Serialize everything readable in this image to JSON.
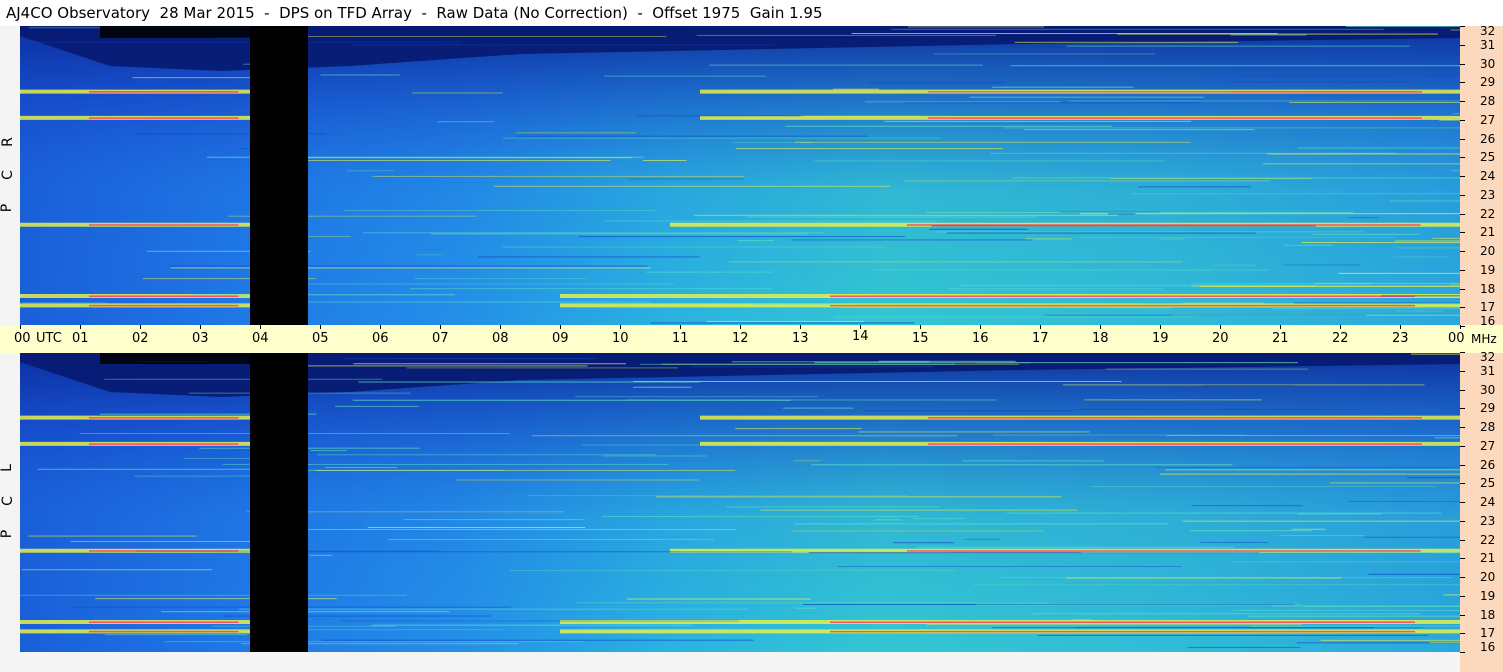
{
  "title": "AJ4CO Observatory  28 Mar 2015  -  DPS on TFD Array  -  Raw Data (No Correction)  -  Offset 1975  Gain 1.95",
  "chart_data": [
    {
      "type": "heatmap",
      "panel": "RCP",
      "polarization_label": [
        "R",
        "C",
        "P"
      ],
      "x_label": "UTC",
      "x_ticks": [
        "00",
        "01",
        "02",
        "03",
        "04",
        "05",
        "06",
        "07",
        "08",
        "09",
        "10",
        "11",
        "12",
        "13",
        "14",
        "15",
        "16",
        "17",
        "18",
        "19",
        "20",
        "21",
        "22",
        "23",
        "00"
      ],
      "y_unit": "MHz",
      "y_range": [
        16,
        32
      ],
      "y_ticks": [
        32,
        31,
        30,
        29,
        28,
        27,
        26,
        25,
        24,
        23,
        22,
        21,
        20,
        19,
        18,
        17,
        16
      ],
      "data_gap_utc": [
        "03:50",
        "04:48"
      ],
      "strong_emission_bands_mhz": [
        28.5,
        27.1,
        21.4,
        17.6,
        17.1
      ]
    },
    {
      "type": "heatmap",
      "panel": "LCP",
      "polarization_label": [
        "L",
        "C",
        "P"
      ],
      "x_label": "UTC",
      "x_ticks": [
        "00",
        "01",
        "02",
        "03",
        "04",
        "05",
        "06",
        "07",
        "08",
        "09",
        "10",
        "11",
        "12",
        "13",
        "14",
        "15",
        "16",
        "17",
        "18",
        "19",
        "20",
        "21",
        "22",
        "23",
        "00"
      ],
      "y_unit": "MHz",
      "y_range": [
        16,
        32
      ],
      "y_ticks": [
        32,
        31,
        30,
        29,
        28,
        27,
        26,
        25,
        24,
        23,
        22,
        21,
        20,
        19,
        18,
        17,
        16
      ],
      "data_gap_utc": [
        "03:50",
        "04:48"
      ],
      "strong_emission_bands_mhz": [
        28.5,
        27.1,
        21.4,
        17.6,
        17.1
      ]
    }
  ],
  "colors": {
    "background_low": "#0b2a9a",
    "background_mid": "#1e7ee8",
    "background_high": "#3fd3c8",
    "band_yellow": "#e6ee4a",
    "band_red": "#ff3a66",
    "gap": "#000000",
    "axis_band": "#ffffcc",
    "right_scale": "#fcd9bd"
  }
}
